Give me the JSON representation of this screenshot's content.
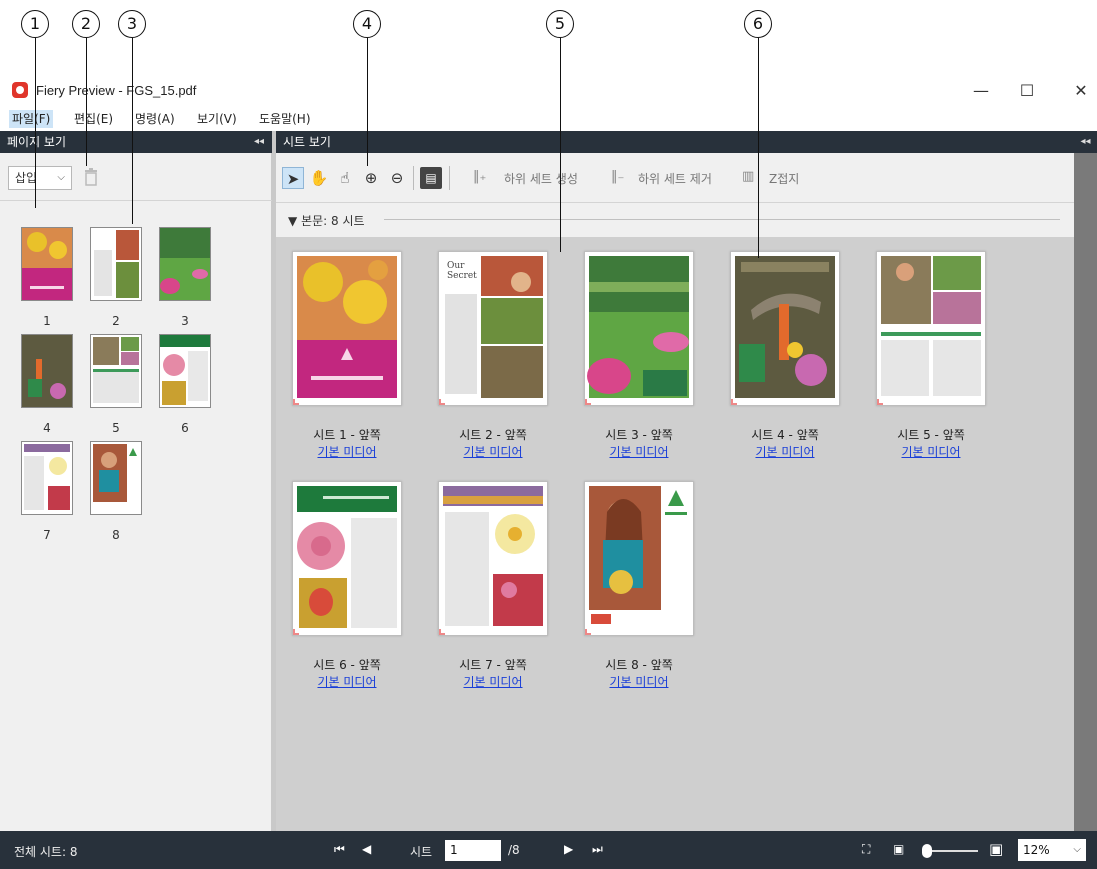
{
  "callouts": [
    "1",
    "2",
    "3",
    "4",
    "5",
    "6"
  ],
  "window": {
    "title": "Fiery Preview - FGS_15.pdf",
    "minimize": "—",
    "maximize": "☐",
    "close": "✕"
  },
  "menu": [
    "파일(F)",
    "편집(E)",
    "명령(A)",
    "보기(V)",
    "도움말(H)"
  ],
  "left_panel": {
    "title": "페이지 보기",
    "collapse": "◂◂",
    "insert_select": "삽입",
    "thumbnails": [
      "1",
      "2",
      "3",
      "4",
      "5",
      "6",
      "7",
      "8"
    ]
  },
  "right_panel": {
    "title": "시트 보기",
    "collapse": "◂◂",
    "toolbar": {
      "add_subset": "하위 세트 생성",
      "remove_subset": "하위 세트 제거",
      "z_fold": "Z접지"
    },
    "section": "본문: 8 시트",
    "sheets": [
      {
        "title": "시트 1 - 앞쪽",
        "media": "기본 미디어"
      },
      {
        "title": "시트 2 - 앞쪽",
        "media": "기본 미디어"
      },
      {
        "title": "시트 3 - 앞쪽",
        "media": "기본 미디어"
      },
      {
        "title": "시트 4 - 앞쪽",
        "media": "기본 미디어"
      },
      {
        "title": "시트 5 - 앞쪽",
        "media": "기본 미디어"
      },
      {
        "title": "시트 6 - 앞쪽",
        "media": "기본 미디어"
      },
      {
        "title": "시트 7 - 앞쪽",
        "media": "기본 미디어"
      },
      {
        "title": "시트 8 - 앞쪽",
        "media": "기본 미디어"
      }
    ]
  },
  "statusbar": {
    "total": "전체 시트: 8",
    "sheet_label": "시트",
    "current_page": "1",
    "page_total": "/8",
    "zoom": "12%"
  },
  "colors": {
    "dark_bar": "#28313b",
    "sheet_area": "#cfcfcf",
    "link": "#1a3fd8",
    "menu_highlight": "#cde4f7"
  }
}
